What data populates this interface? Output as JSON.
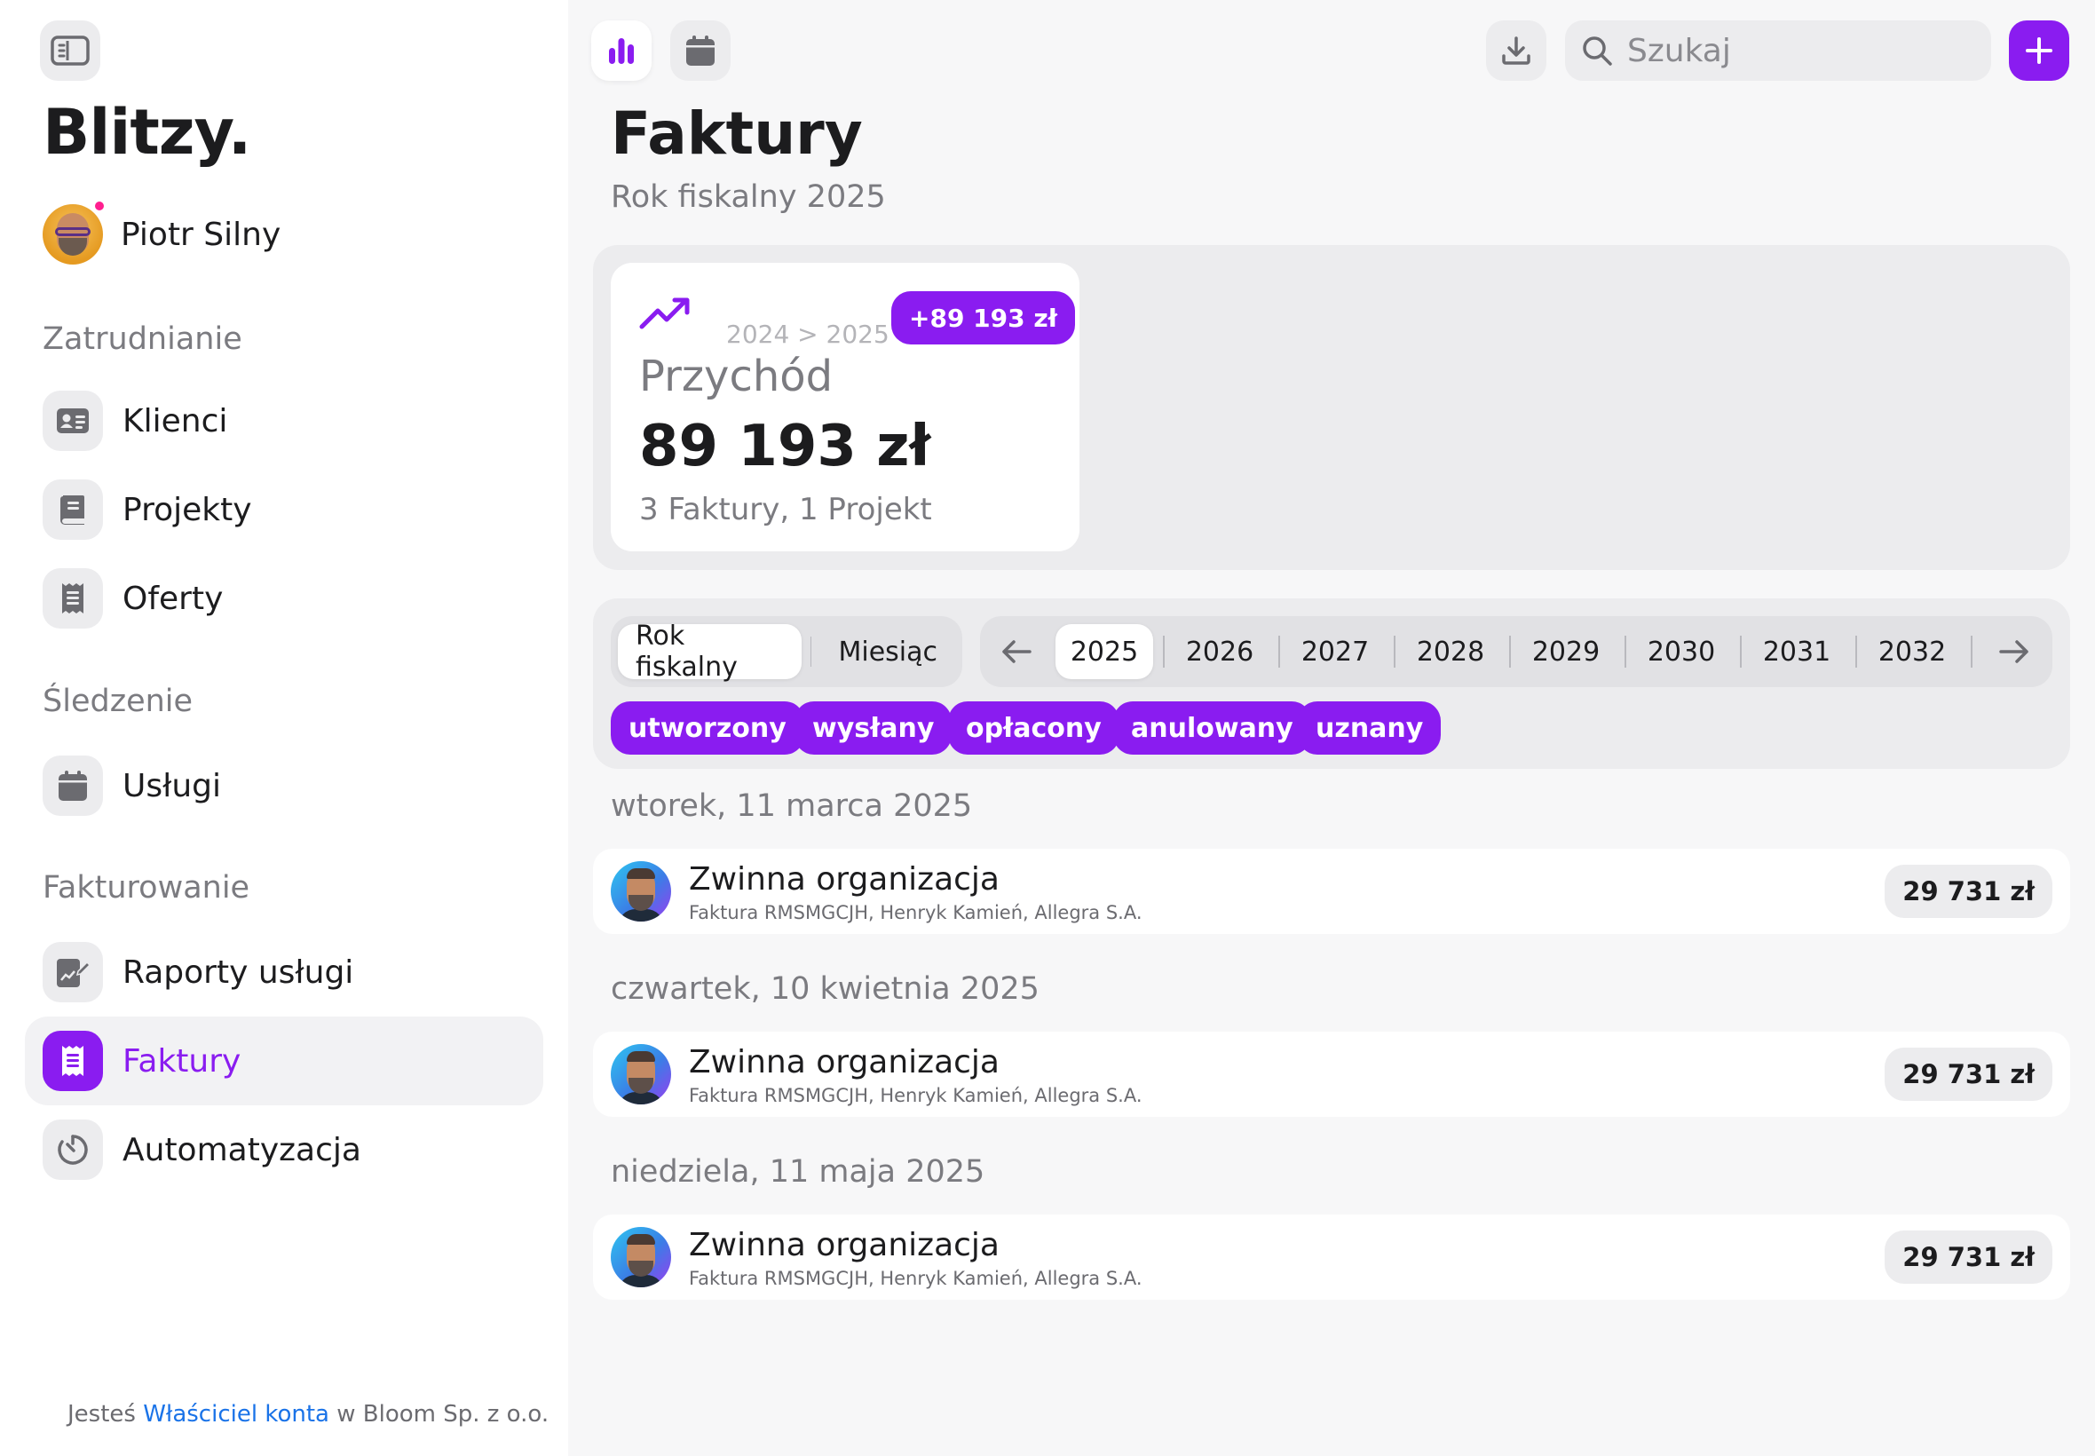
{
  "sidebar": {
    "brand": "Blitzy.",
    "user": {
      "name": "Piotr Silny"
    },
    "sections": [
      {
        "label": "Zatrudnianie",
        "items": [
          {
            "label": "Klienci",
            "icon": "contact-card-icon"
          },
          {
            "label": "Projekty",
            "icon": "book-icon"
          },
          {
            "label": "Oferty",
            "icon": "document-list-icon"
          }
        ]
      },
      {
        "label": "Śledzenie",
        "items": [
          {
            "label": "Usługi",
            "icon": "calendar-icon"
          }
        ]
      },
      {
        "label": "Fakturowanie",
        "items": [
          {
            "label": "Raporty usługi",
            "icon": "report-edit-icon"
          },
          {
            "label": "Faktury",
            "icon": "receipt-icon",
            "active": true
          },
          {
            "label": "Automatyzacja",
            "icon": "timer-icon"
          }
        ]
      }
    ],
    "footer": {
      "prefix": "Jesteś",
      "role": "Właściciel konta",
      "suffix": "w Bloom Sp. z o.o."
    }
  },
  "topbar": {
    "search_placeholder": "Szukaj",
    "icons": [
      "chart-icon",
      "calendar-icon",
      "download-icon",
      "search-icon",
      "plus-icon"
    ]
  },
  "page": {
    "title": "Faktury",
    "subtitle": "Rok fiskalny 2025"
  },
  "stat": {
    "range": "2024 > 2025",
    "badge": "+89 193 zł",
    "label": "Przychód",
    "value": "89 193 zł",
    "sub": "3 Faktury, 1 Projekt"
  },
  "filters": {
    "period_tabs": [
      {
        "label": "Rok fiskalny",
        "active": true
      },
      {
        "label": "Miesiąc",
        "active": false
      }
    ],
    "years": [
      "2025",
      "2026",
      "2027",
      "2028",
      "2029",
      "2030",
      "2031",
      "2032"
    ],
    "active_year": "2025",
    "status_chips": [
      "utworzony",
      "wysłany",
      "opłacony",
      "anulowany",
      "uznany"
    ]
  },
  "invoices": [
    {
      "date": "wtorek, 11 marca 2025",
      "title": "Zwinna organizacja",
      "sub": "Faktura RMSMGCJH, Henryk Kamień, Allegra S.A.",
      "amount": "29 731 zł"
    },
    {
      "date": "czwartek, 10 kwietnia 2025",
      "title": "Zwinna organizacja",
      "sub": "Faktura RMSMGCJH, Henryk Kamień, Allegra S.A.",
      "amount": "29 731 zł"
    },
    {
      "date": "niedziela, 11 maja 2025",
      "title": "Zwinna organizacja",
      "sub": "Faktura RMSMGCJH, Henryk Kamień, Allegra S.A.",
      "amount": "29 731 zł"
    }
  ],
  "colors": {
    "accent": "#8a1cf0",
    "notification": "#ff1f8f",
    "link": "#1a73e8"
  }
}
